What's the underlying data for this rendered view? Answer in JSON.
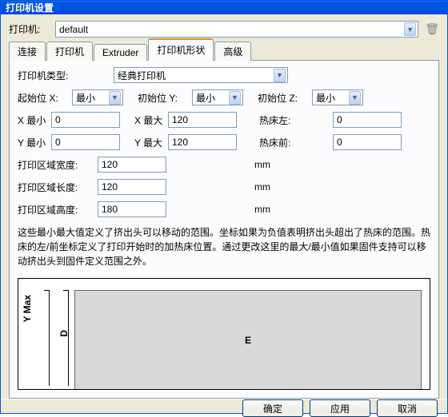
{
  "title": "打印机设置",
  "printer_row": {
    "label": "打印机:",
    "value": "default",
    "trash_icon": "🗑"
  },
  "tabs": {
    "t0": "连接",
    "t1": "打印机",
    "t2": "Extruder",
    "t3": "打印机形状",
    "t4": "高级"
  },
  "type_row": {
    "label": "打印机类型:",
    "value": "经典打印机"
  },
  "home_row": {
    "x_label": "起始位 X:",
    "x_value": "最小",
    "y_label": "初始位 Y:",
    "y_value": "最小",
    "z_label": "初始位 Z:",
    "z_value": "最小"
  },
  "xrow": {
    "min_label": "X 最小",
    "min_value": "0",
    "max_label": "X 最大",
    "max_value": "120",
    "bed_left_label": "热床左:",
    "bed_left_value": "0"
  },
  "yrow": {
    "min_label": "Y 最小",
    "min_value": "0",
    "max_label": "Y 最大",
    "max_value": "120",
    "bed_front_label": "热床前:",
    "bed_front_value": "0"
  },
  "area": {
    "width_label": "打印区域宽度:",
    "width_value": "120",
    "width_unit": "mm",
    "depth_label": "打印区域长度:",
    "depth_value": "120",
    "depth_unit": "mm",
    "height_label": "打印区域高度:",
    "height_value": "180",
    "height_unit": "mm"
  },
  "description": "这些最小最大值定义了挤出头可以移动的范围。坐标如果为负值表明挤出头超出了热床的范围。热床的左/前坐标定义了打印开始时的加热床位置。通过更改这里的最大/最小值如果固件支持可以移动挤出头到固件定义范围之外。",
  "preview": {
    "ymax": "Y Max",
    "d": "D",
    "e": "E"
  },
  "buttons": {
    "ok": "确定",
    "apply": "应用",
    "cancel": "取消"
  }
}
